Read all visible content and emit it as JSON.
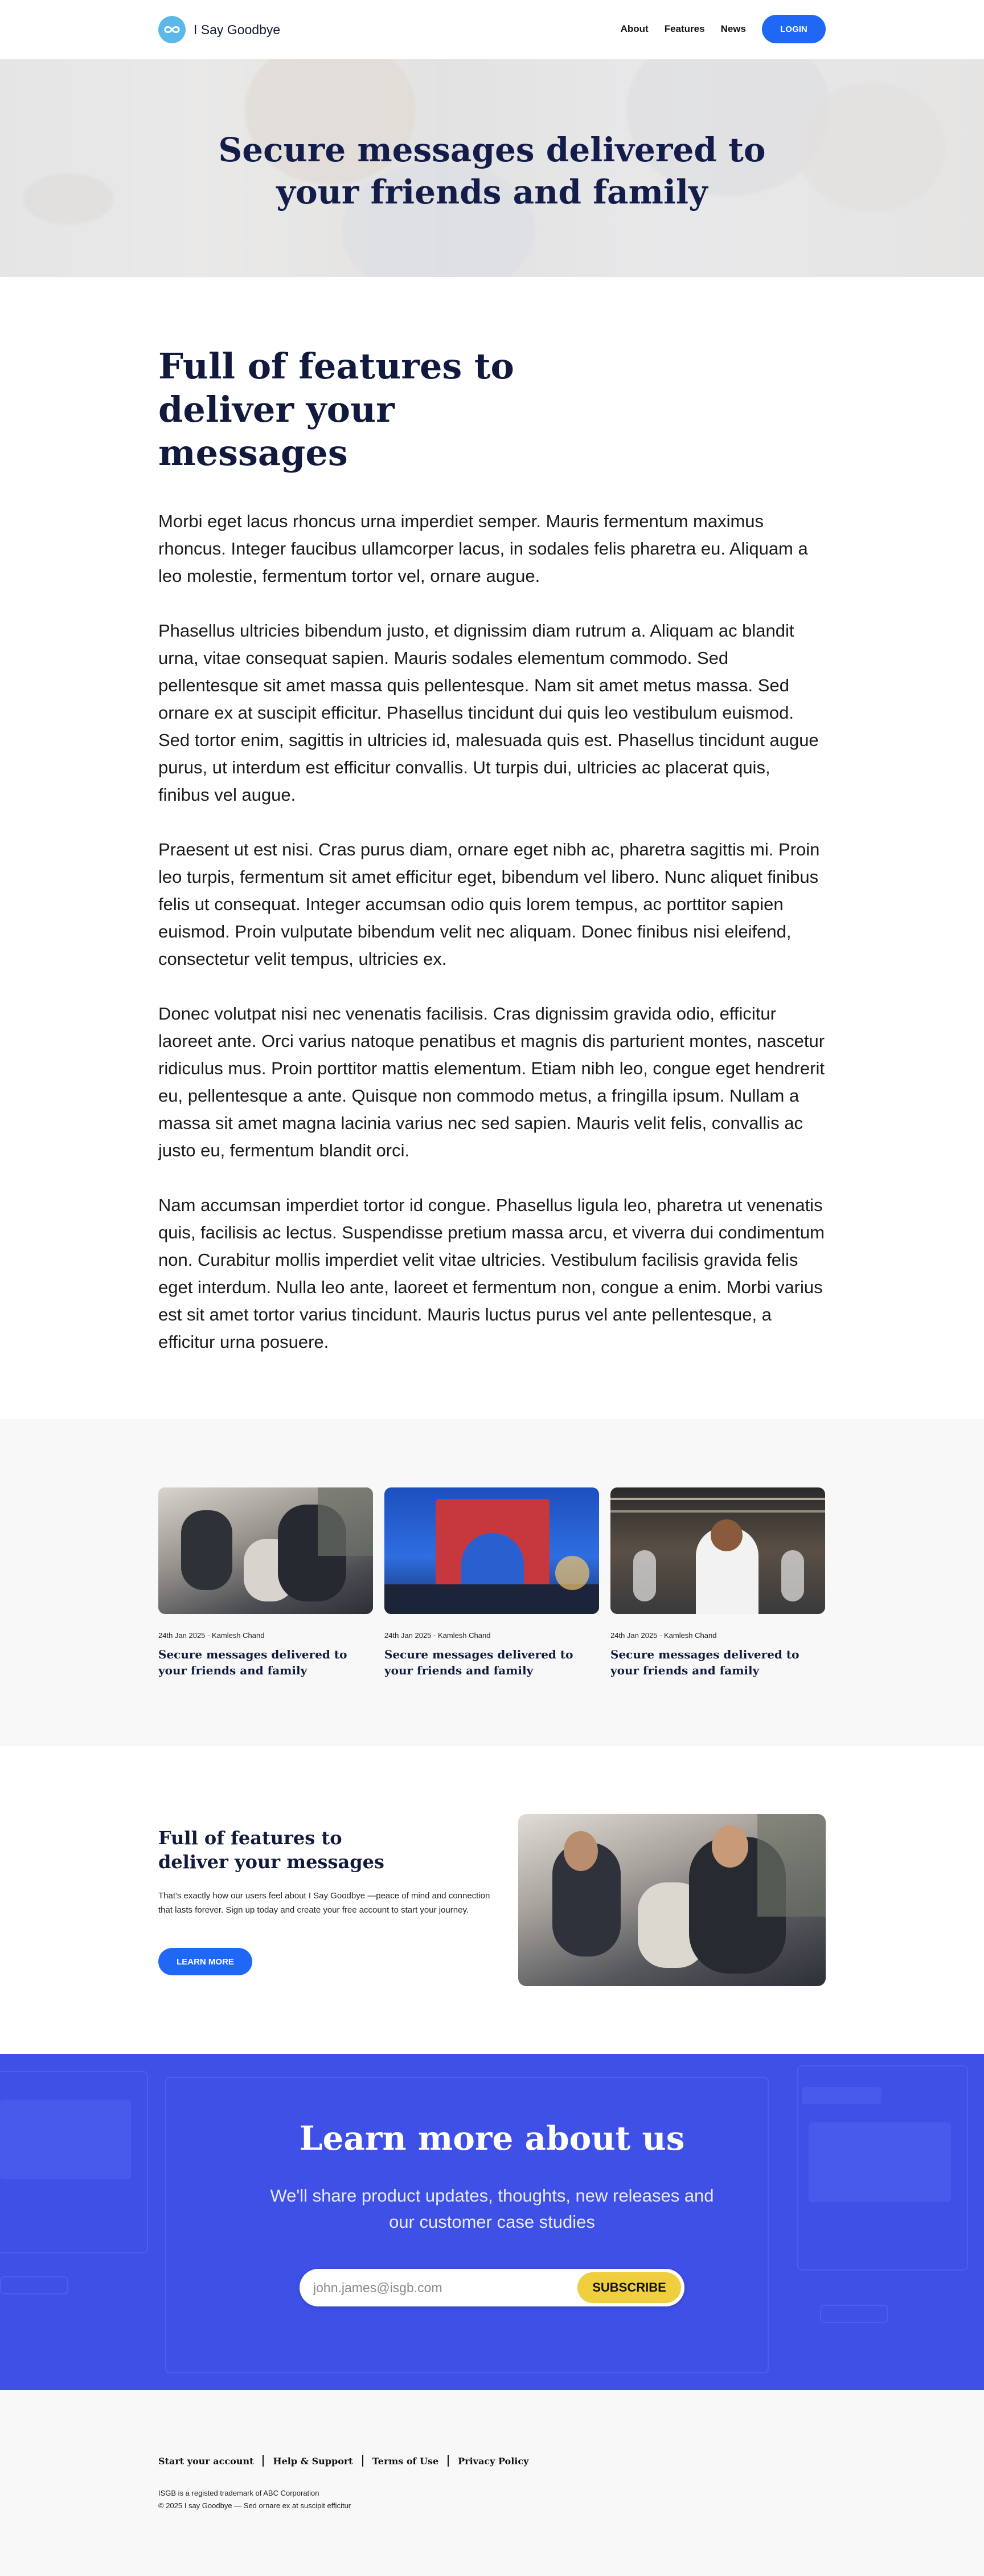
{
  "header": {
    "brand_name": "I Say Goodbye",
    "logo_icon": "infinity-logo-icon",
    "nav": [
      "About",
      "Features",
      "News"
    ],
    "login_label": "LOGIN"
  },
  "hero": {
    "title": "Secure messages delivered to your friends and family"
  },
  "article": {
    "heading": "Full of features to deliver your messages",
    "paragraphs": [
      "Morbi eget lacus rhoncus urna imperdiet semper. Mauris fermentum maximus rhoncus. Integer faucibus ullamcorper lacus, in sodales felis pharetra eu. Aliquam a leo molestie, fermentum tortor vel, ornare augue.",
      "Phasellus ultricies bibendum justo, et dignissim diam rutrum a. Aliquam ac blandit urna, vitae consequat sapien. Mauris sodales elementum commodo. Sed pellentesque sit amet massa quis pellentesque. Nam sit amet metus massa. Sed ornare ex at suscipit efficitur. Phasellus tincidunt dui quis leo vestibulum euismod. Sed tortor enim, sagittis in ultricies id, malesuada quis est. Phasellus tincidunt augue purus, ut interdum est efficitur convallis. Ut turpis dui, ultricies ac placerat quis, finibus vel augue.",
      "Praesent ut est nisi. Cras purus diam, ornare eget nibh ac, pharetra sagittis mi. Proin leo turpis, fermentum sit amet efficitur eget, bibendum vel libero. Nunc aliquet finibus felis ut consequat. Integer accumsan odio quis lorem tempus, ac porttitor sapien euismod. Proin vulputate bibendum velit nec aliquam. Donec finibus nisi eleifend, consectetur velit tempus, ultricies ex.",
      "Donec volutpat nisi nec venenatis facilisis. Cras dignissim gravida odio, efficitur laoreet ante. Orci varius natoque penatibus et magnis dis parturient montes, nascetur ridiculus mus. Proin porttitor mattis elementum. Etiam nibh leo, congue eget hendrerit eu, pellentesque a ante. Quisque non commodo metus, a fringilla ipsum. Nullam a massa sit amet magna lacinia varius nec sed sapien. Mauris velit felis, convallis ac justo eu, fermentum blandit orci.",
      "Nam accumsan imperdiet tortor id congue. Phasellus ligula leo, pharetra ut venenatis quis, facilisis ac lectus. Suspendisse pretium massa arcu, et viverra dui condimentum non. Curabitur mollis imperdiet velit vitae ultricies. Vestibulum facilisis gravida felis eget interdum. Nulla leo ante, laoreet et fermentum non, congue a enim. Morbi varius est sit amet tortor varius tincidunt. Mauris luctus purus vel ante pellentesque, a efficitur urna posuere."
    ]
  },
  "cards": [
    {
      "meta": "24th Jan 2025 - Kamlesh Chand",
      "title": "Secure messages delivered to your friends and family",
      "image": "family-photo"
    },
    {
      "meta": "24th Jan 2025 - Kamlesh Chand",
      "title": "Secure messages delivered to your friends and family",
      "image": "red-arch-photo"
    },
    {
      "meta": "24th Jan 2025 - Kamlesh Chand",
      "title": "Secure messages delivered to your friends and family",
      "image": "chef-kitchen-photo"
    }
  ],
  "feature": {
    "title": "Full of features to deliver your messages",
    "text": "That's exactly how our users feel about I Say Goodbye —peace of mind and connection that lasts forever. Sign up today and create your free account to start your journey.",
    "button_label": "LEARN MORE"
  },
  "subscribe": {
    "title": "Learn more about us",
    "subtitle": "We'll share product updates, thoughts, new releases and our customer case studies",
    "email_placeholder": "john.james@isgb.com",
    "button_label": "SUBSCRIBE",
    "accent": "#3e50e6",
    "button_color": "#f0cf3f"
  },
  "footer": {
    "links": [
      "Start your account",
      "Help & Support",
      "Terms of Use",
      "Privacy Policy"
    ],
    "trademark": "ISGB is a registed trademark of ABC Corporation",
    "copyright": "© 2025 I say Goodbye — Sed ornare ex at suscipit efficitur"
  }
}
